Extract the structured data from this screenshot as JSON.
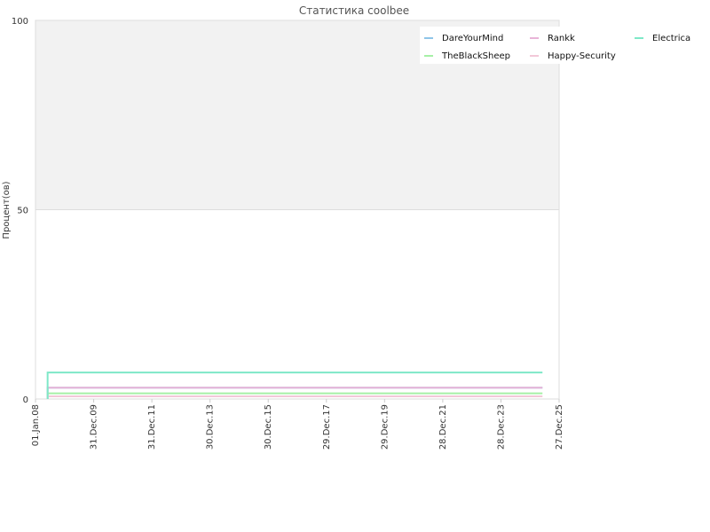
{
  "chart_data": {
    "type": "line",
    "title": "Статистика coolbee",
    "xlabel": "",
    "ylabel": "Процент(ов)",
    "ylim": [
      0,
      100
    ],
    "yticks": [
      0,
      50,
      100
    ],
    "x_tick_labels": [
      "01.Jan.08",
      "31.Dec.09",
      "31.Dec.11",
      "30.Dec.13",
      "30.Dec.15",
      "29.Dec.17",
      "29.Dec.19",
      "28.Dec.21",
      "28.Dec.23",
      "27.Dec.25"
    ],
    "x_range": [
      "2008-01-01",
      "2025-12-27"
    ],
    "upper_band": {
      "from": 50,
      "to": 100,
      "color": "#f2f2f2"
    },
    "grid": true,
    "legend_position": "top-right",
    "series": [
      {
        "name": "DareYourMind",
        "color": "#8fc5e8",
        "x": [
          "2008-06-01",
          "2025-06-01"
        ],
        "values": [
          3,
          3
        ]
      },
      {
        "name": "TheBlackSheep",
        "color": "#a6f0a6",
        "x": [
          "2008-06-01",
          "2025-06-01"
        ],
        "values": [
          1.5,
          1.5
        ]
      },
      {
        "name": "Rankk",
        "color": "#e8b4d8",
        "x": [
          "2008-06-01",
          "2025-06-01"
        ],
        "values": [
          3,
          3
        ]
      },
      {
        "name": "Happy-Security",
        "color": "#f2c8d8",
        "x": [
          "2008-06-01",
          "2025-06-01"
        ],
        "values": [
          0.7,
          0.7
        ]
      },
      {
        "name": "Electrica",
        "color": "#7ee8c8",
        "x": [
          "2008-06-01",
          "2025-06-01"
        ],
        "values": [
          7,
          7
        ]
      }
    ]
  }
}
